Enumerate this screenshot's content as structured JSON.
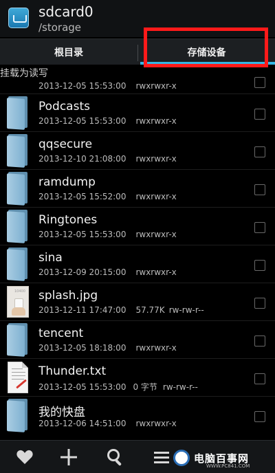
{
  "header": {
    "title": "sdcard0",
    "path": "/storage",
    "app_icon": "storage-folder-icon"
  },
  "tabs": [
    {
      "label": "根目录",
      "active": false
    },
    {
      "label": "存储设备",
      "active": true
    }
  ],
  "colors": {
    "accent": "#35b5e5",
    "highlight_box": "#ff1a1a",
    "background": "#000000"
  },
  "read_only_label": "挂载为读写",
  "partial_row": {
    "date": "2013-12-05 15:53:00",
    "perms": "rwxrwxr-x"
  },
  "files": [
    {
      "name": "Podcasts",
      "date": "2013-12-05 15:53:00",
      "size": "",
      "perms": "rwxrwxr-x",
      "icon": "folder-icon"
    },
    {
      "name": "qqsecure",
      "date": "2013-12-10 21:08:00",
      "size": "",
      "perms": "rwxrwxr-x",
      "icon": "folder-icon"
    },
    {
      "name": "ramdump",
      "date": "2013-12-05 15:52:00",
      "size": "",
      "perms": "rwxrwxr-x",
      "icon": "folder-icon"
    },
    {
      "name": "Ringtones",
      "date": "2013-12-05 15:53:00",
      "size": "",
      "perms": "rwxrwxr-x",
      "icon": "folder-icon"
    },
    {
      "name": "sina",
      "date": "2013-12-09 20:15:00",
      "size": "",
      "perms": "rwxrwxr-x",
      "icon": "folder-icon"
    },
    {
      "name": "splash.jpg",
      "date": "2013-12-11 17:47:00",
      "size": "57.77K",
      "perms": "rw-rw-r--",
      "icon": "image-file-icon"
    },
    {
      "name": "tencent",
      "date": "2013-12-05 18:18:00",
      "size": "",
      "perms": "rwxrwxr-x",
      "icon": "folder-icon"
    },
    {
      "name": "Thunder.txt",
      "date": "2013-12-05 15:53:00",
      "size": "0 字节",
      "perms": "rw-rw-r--",
      "icon": "text-file-icon"
    },
    {
      "name": "我的快盘",
      "date": "2013-12-06 14:51:00",
      "size": "",
      "perms": "rwxrwxr-x",
      "icon": "folder-icon"
    }
  ],
  "toolbar": {
    "favorites_icon": "heart-icon",
    "add_icon": "plus-icon",
    "search_icon": "search-icon",
    "menu_icon": "menu-icon"
  },
  "watermark": {
    "text": "电脑百事网",
    "url": "WWW.PC841.COM"
  }
}
